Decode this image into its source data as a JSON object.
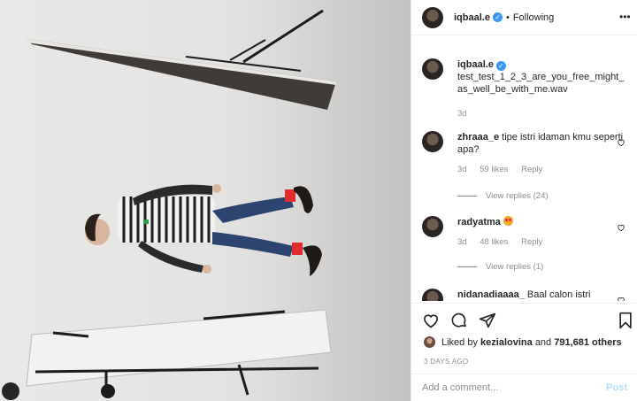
{
  "header": {
    "username": "iqbaal.e",
    "separator": "•",
    "follow_status": "Following",
    "more_icon": "more-options-icon"
  },
  "caption": {
    "username": "iqbaal.e",
    "text": "test_test_1_2_3_are_you_free_might_as_well_be_with_me.wav",
    "time": "3d"
  },
  "comments": [
    {
      "username": "zhraaa_e",
      "text": "tipe istri idaman kmu seperti apa?",
      "time": "3d",
      "likes": "59 likes",
      "reply": "Reply",
      "view_replies": "View replies (24)"
    },
    {
      "username": "radyatma",
      "text": "",
      "emoji": "heart-eyes-emoji",
      "time": "3d",
      "likes": "48 likes",
      "reply": "Reply",
      "view_replies": "View replies (1)"
    },
    {
      "username": "nidanadiaaaa_",
      "text": "Baal calon istri"
    }
  ],
  "actions": {
    "like_icon": "heart-icon",
    "comment_icon": "comment-icon",
    "share_icon": "paper-plane-icon",
    "save_icon": "bookmark-icon"
  },
  "likes_line": {
    "prefix": "Liked by",
    "user": "kezialovina",
    "and": "and",
    "others": "791,681 others"
  },
  "timestamp": "3 DAYS AGO",
  "add_comment": {
    "placeholder": "Add a comment...",
    "post_label": "Post"
  },
  "colors": {
    "verified": "#3897f0",
    "text": "#262626",
    "muted": "#8e8e8e",
    "post_disabled": "#b2dffc"
  }
}
